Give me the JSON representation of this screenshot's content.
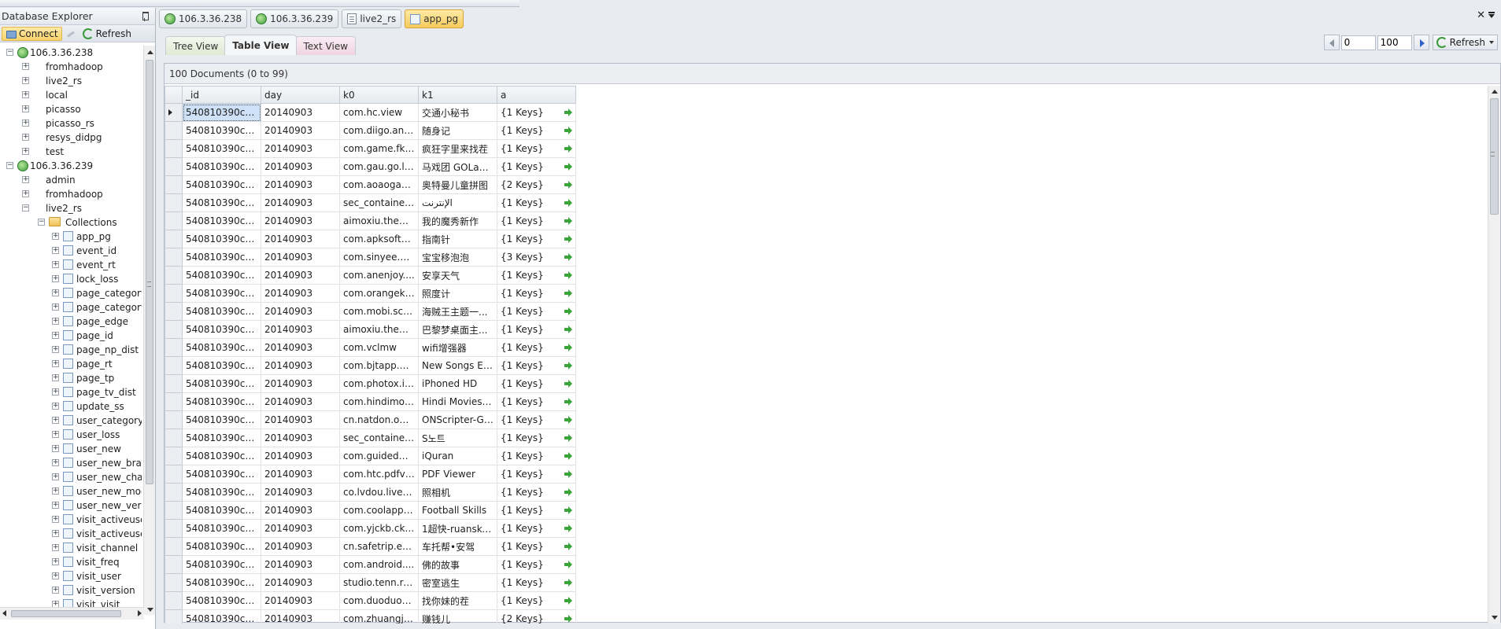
{
  "explorer": {
    "title": "Database Explorer",
    "connect_label": "Connect",
    "refresh_label": "Refresh",
    "tree": [
      {
        "level": 0,
        "icon": "server-icon",
        "label": "106.3.36.238",
        "expander": "−"
      },
      {
        "level": 1,
        "icon": null,
        "label": "fromhadoop",
        "expander": "+"
      },
      {
        "level": 1,
        "icon": null,
        "label": "live2_rs",
        "expander": "+"
      },
      {
        "level": 1,
        "icon": null,
        "label": "local",
        "expander": "+"
      },
      {
        "level": 1,
        "icon": null,
        "label": "picasso",
        "expander": "+"
      },
      {
        "level": 1,
        "icon": null,
        "label": "picasso_rs",
        "expander": "+"
      },
      {
        "level": 1,
        "icon": null,
        "label": "resys_didpg",
        "expander": "+"
      },
      {
        "level": 1,
        "icon": null,
        "label": "test",
        "expander": "+"
      },
      {
        "level": 0,
        "icon": "server-icon",
        "label": "106.3.36.239",
        "expander": "−"
      },
      {
        "level": 1,
        "icon": null,
        "label": "admin",
        "expander": "+"
      },
      {
        "level": 1,
        "icon": null,
        "label": "fromhadoop",
        "expander": "+"
      },
      {
        "level": 1,
        "icon": null,
        "label": "live2_rs",
        "expander": "−"
      },
      {
        "level": 2,
        "icon": "folder-icon",
        "label": "Collections",
        "expander": "−"
      },
      {
        "level": 3,
        "icon": "collection-icon",
        "label": "app_pg",
        "expander": "+"
      },
      {
        "level": 3,
        "icon": "collection-icon",
        "label": "event_id",
        "expander": "+"
      },
      {
        "level": 3,
        "icon": "collection-icon",
        "label": "event_rt",
        "expander": "+"
      },
      {
        "level": 3,
        "icon": "collection-icon",
        "label": "lock_loss",
        "expander": "+"
      },
      {
        "level": 3,
        "icon": "collection-icon",
        "label": "page_category",
        "expander": "+"
      },
      {
        "level": 3,
        "icon": "collection-icon",
        "label": "page_category_",
        "expander": "+"
      },
      {
        "level": 3,
        "icon": "collection-icon",
        "label": "page_edge",
        "expander": "+"
      },
      {
        "level": 3,
        "icon": "collection-icon",
        "label": "page_id",
        "expander": "+"
      },
      {
        "level": 3,
        "icon": "collection-icon",
        "label": "page_np_dist",
        "expander": "+"
      },
      {
        "level": 3,
        "icon": "collection-icon",
        "label": "page_rt",
        "expander": "+"
      },
      {
        "level": 3,
        "icon": "collection-icon",
        "label": "page_tp",
        "expander": "+"
      },
      {
        "level": 3,
        "icon": "collection-icon",
        "label": "page_tv_dist",
        "expander": "+"
      },
      {
        "level": 3,
        "icon": "collection-icon",
        "label": "update_ss",
        "expander": "+"
      },
      {
        "level": 3,
        "icon": "collection-icon",
        "label": "user_category",
        "expander": "+"
      },
      {
        "level": 3,
        "icon": "collection-icon",
        "label": "user_loss",
        "expander": "+"
      },
      {
        "level": 3,
        "icon": "collection-icon",
        "label": "user_new",
        "expander": "+"
      },
      {
        "level": 3,
        "icon": "collection-icon",
        "label": "user_new_brand",
        "expander": "+"
      },
      {
        "level": 3,
        "icon": "collection-icon",
        "label": "user_new_chan",
        "expander": "+"
      },
      {
        "level": 3,
        "icon": "collection-icon",
        "label": "user_new_mode",
        "expander": "+"
      },
      {
        "level": 3,
        "icon": "collection-icon",
        "label": "user_new_versi",
        "expander": "+"
      },
      {
        "level": 3,
        "icon": "collection-icon",
        "label": "visit_activeuser_",
        "expander": "+"
      },
      {
        "level": 3,
        "icon": "collection-icon",
        "label": "visit_activeuser_",
        "expander": "+"
      },
      {
        "level": 3,
        "icon": "collection-icon",
        "label": "visit_channel",
        "expander": "+"
      },
      {
        "level": 3,
        "icon": "collection-icon",
        "label": "visit_freq",
        "expander": "+"
      },
      {
        "level": 3,
        "icon": "collection-icon",
        "label": "visit_user",
        "expander": "+"
      },
      {
        "level": 3,
        "icon": "collection-icon",
        "label": "visit_version",
        "expander": "+"
      },
      {
        "level": 3,
        "icon": "collection-icon",
        "label": "visit_visit",
        "expander": "+"
      }
    ]
  },
  "doc_tabs": [
    {
      "label": "106.3.36.238",
      "icon": "server-icon",
      "active": false
    },
    {
      "label": "106.3.36.239",
      "icon": "server-icon",
      "active": false
    },
    {
      "label": "live2_rs",
      "icon": "document-icon",
      "active": false
    },
    {
      "label": "app_pg",
      "icon": "collection-icon",
      "active": true
    }
  ],
  "view_tabs": {
    "tree": "Tree View",
    "table": "Table View",
    "text": "Text View",
    "active": "table"
  },
  "paging": {
    "skip": "0",
    "limit": "100",
    "refresh_label": "Refresh"
  },
  "doc_count": "100 Documents (0 to 99)",
  "grid": {
    "columns": [
      "_id",
      "day",
      "k0",
      "k1",
      "a"
    ],
    "rows": [
      [
        "540810390cf2e...",
        "20140903",
        "com.hc.view",
        "交通小秘书",
        "{1 Keys}"
      ],
      [
        "540810390cf2e...",
        "20140903",
        "com.diigo.and...",
        "随身记",
        "{1 Keys}"
      ],
      [
        "540810390cf2e...",
        "20140903",
        "com.game.fk_...",
        "疯狂字里来找茬",
        "{1 Keys}"
      ],
      [
        "540810390cf2e...",
        "20140903",
        "com.gau.go.la...",
        "马戏团 GOLau...",
        "{1 Keys}"
      ],
      [
        "540810390cf2e...",
        "20140903",
        "com.aoaogam...",
        "奥特曼儿童拼图",
        "{2 Keys}"
      ],
      [
        "540810390cf2e...",
        "20140903",
        "sec_container_...",
        "الإنترنت",
        "{1 Keys}"
      ],
      [
        "540810390cf2e...",
        "20140903",
        "aimoxiu.theme...",
        "我的魔秀新作",
        "{1 Keys}"
      ],
      [
        "540810390cf2e...",
        "20140903",
        "com.apksoftw...",
        "指南针",
        "{1 Keys}"
      ],
      [
        "540810390cf2e...",
        "20140903",
        "com.sinyee.ba...",
        "宝宝移泡泡",
        "{3 Keys}"
      ],
      [
        "540810390cf2e...",
        "20140903",
        "com.anenjoy....",
        "安享天气",
        "{1 Keys}"
      ],
      [
        "540810390cf2e...",
        "20140903",
        "com.orangekit...",
        "照度计",
        "{1 Keys}"
      ],
      [
        "540810390cf2e...",
        "20140903",
        "com.mobi.scre...",
        "海贼王主题一...",
        "{1 Keys}"
      ],
      [
        "540810390cf2e...",
        "20140903",
        "aimoxiu.theme...",
        "巴黎梦桌面主...",
        "{1 Keys}"
      ],
      [
        "540810390cf2e...",
        "20140903",
        "com.vclmw",
        "wifi增强器",
        "{1 Keys}"
      ],
      [
        "540810390cf2e...",
        "20140903",
        "com.bjtapp.ne...",
        "New Songs En...",
        "{1 Keys}"
      ],
      [
        "540810390cf2e...",
        "20140903",
        "com.photox.ip...",
        "iPhoned HD",
        "{1 Keys}"
      ],
      [
        "540810390cf2e...",
        "20140903",
        "com.hindimov...",
        "Hindi Movies ...",
        "{1 Keys}"
      ],
      [
        "540810390cf2e...",
        "20140903",
        "cn.natdon.ons...",
        "ONScripter-GBK",
        "{1 Keys}"
      ],
      [
        "540810390cf2e...",
        "20140903",
        "sec_container_...",
        "S노트",
        "{1 Keys}"
      ],
      [
        "540810390cf2e...",
        "20140903",
        "com.guidedwa...",
        "iQuran",
        "{1 Keys}"
      ],
      [
        "540810390cf2e...",
        "20140903",
        "com.htc.pdfvi...",
        "PDF Viewer",
        "{1 Keys}"
      ],
      [
        "540810390cf2e...",
        "20140903",
        "co.lvdou.livew...",
        "照相机",
        "{1 Keys}"
      ],
      [
        "540810390cf2e...",
        "20140903",
        "com.coolappst...",
        "Football Skills",
        "{1 Keys}"
      ],
      [
        "540810390cf2e...",
        "20140903",
        "com.yjckb.ckjs...",
        "1超快-ruansky....",
        "{1 Keys}"
      ],
      [
        "540810390cf2e...",
        "20140903",
        "cn.safetrip.edog",
        "车托帮•安驾",
        "{1 Keys}"
      ],
      [
        "540810390cf2e...",
        "20140903",
        "com.android....",
        "佛的故事",
        "{1 Keys}"
      ],
      [
        "540810390cf2e...",
        "20140903",
        "studio.tenn.re...",
        "密室逃生",
        "{1 Keys}"
      ],
      [
        "540810390cf2e...",
        "20140903",
        "com.duoduoa...",
        "找你妹的茬",
        "{1 Keys}"
      ],
      [
        "540810390cf2e...",
        "20140903",
        "com.zhuangjia...",
        "赚钱儿",
        "{2 Keys}"
      ]
    ]
  },
  "colors": {
    "accent_tab": "#f6cb5c",
    "selection": "#cfe1f7",
    "go_arrow": "#3aa33a"
  }
}
